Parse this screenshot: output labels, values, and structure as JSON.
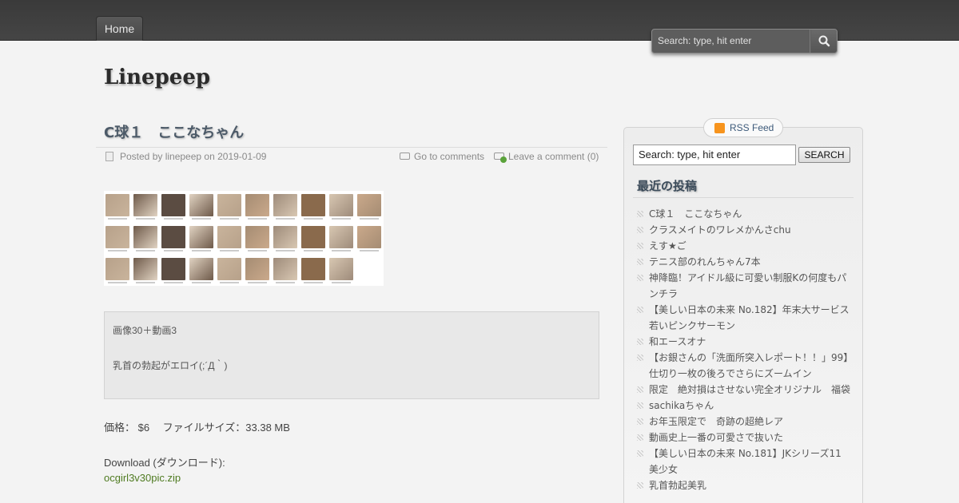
{
  "nav": {
    "home_label": "Home"
  },
  "header_search": {
    "placeholder": "Search: type, hit enter"
  },
  "site": {
    "title": "Linepeep"
  },
  "post": {
    "title": "C球１　ここなちゃん",
    "meta": {
      "posted": "Posted by linepeep on 2019-01-09",
      "go_to_comments": "Go to comments",
      "leave_comment": "Leave a comment (0)"
    },
    "body": {
      "line1": "画像30＋動画3",
      "line2": "乳首の勃起がエロイ(;´Д｀)"
    },
    "price_line": "価格： $6　 ファイルサイズ：33.38 MB",
    "download_label": "Download (ダウンロード):",
    "download_link": "ocgirl3v30pic.zip"
  },
  "sidebar": {
    "rss_label": "RSS Feed",
    "search": {
      "value": "Search: type, hit enter",
      "button_label": "SEARCH"
    },
    "recent_title": "最近の投稿",
    "recent_items": [
      "C球１　ここなちゃん",
      "クラスメイトのワレメかんさchu",
      "えす★ご",
      "テニス部のれんちゃん7本",
      "神降臨！アイドル級に可愛い制服Kの何度もパンチラ",
      "【美しい日本の未来 No.182】年末大サービス　若いピンクサーモン",
      "和エースオナ",
      "【お銀さんの「洗面所突入レポート！！」99】仕切り一枚の後ろでさらにズームイン",
      "限定　絶対損はさせない完全オリジナル　福袋",
      "sachikaちゃん",
      "お年玉限定で　奇跡の超絶レア",
      "動画史上一番の可愛さで抜いた",
      "【美しい日本の未来 No.181】JKシリーズ11　美少女",
      "乳首勃起美乳"
    ]
  },
  "colors": {
    "topbar": "#404040",
    "link_green": "#4f7b21",
    "title_blue_gray": "#4c5a68",
    "rss_orange": "#f7941d"
  }
}
